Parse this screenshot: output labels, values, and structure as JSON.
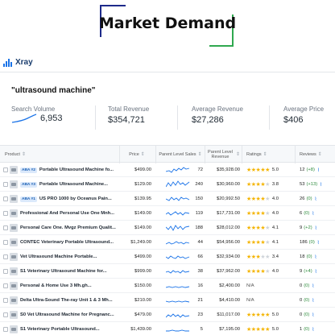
{
  "banner": {
    "title": "Market Demand"
  },
  "app": {
    "name": "Xray"
  },
  "query": "\"ultrasound machine\"",
  "metrics": [
    {
      "label": "Search Volume",
      "value": "6,953"
    },
    {
      "label": "Total Revenue",
      "value": "$354,721"
    },
    {
      "label": "Average Revenue",
      "value": "$27,286"
    },
    {
      "label": "Average Price",
      "value": "$406"
    }
  ],
  "columns": {
    "product": "Product",
    "price": "Price",
    "sales": "Parent Level Sales",
    "revenue": "Parent Level Revenue",
    "ratings": "Ratings",
    "reviews": "Reviews"
  },
  "rows": [
    {
      "aba": "ABA #2",
      "name": "Portable Ultrasound Machine fo...",
      "price": "$499.00",
      "sales": "72",
      "revenue": "$35,928.00",
      "rating": 5.0,
      "rating_text": "5.0",
      "reviews": "12",
      "delta": "(+8)"
    },
    {
      "aba": "ABA #3",
      "name": "Portable Ultrasound Machine...",
      "price": "$129.00",
      "sales": "240",
      "revenue": "$30,960.00",
      "rating": 3.8,
      "rating_text": "3.8",
      "reviews": "53",
      "delta": "(+13)"
    },
    {
      "aba": "ABA #1",
      "name": "US PRO 1000 by Oceanus Pain...",
      "price": "$139.95",
      "sales": "150",
      "revenue": "$20,992.50",
      "rating": 4.0,
      "rating_text": "4.0",
      "reviews": "26",
      "delta": "(0)"
    },
    {
      "aba": "",
      "name": "Professional And Personal Use One Mnh...",
      "price": "$149.00",
      "sales": "119",
      "revenue": "$17,731.00",
      "rating": 4.0,
      "rating_text": "4.0",
      "reviews": "6",
      "delta": "(0)"
    },
    {
      "aba": "",
      "name": "Personal Care One. Mvgz Premium Qualit...",
      "price": "$149.00",
      "sales": "188",
      "revenue": "$28,012.00",
      "rating": 4.1,
      "rating_text": "4.1",
      "reviews": "9",
      "delta": "(+2)"
    },
    {
      "aba": "",
      "name": "CONTEC Veterinary Portable Ultrasound...",
      "price": "$1,249.00",
      "sales": "44",
      "revenue": "$54,956.00",
      "rating": 4.1,
      "rating_text": "4.1",
      "reviews": "186",
      "delta": "(0)"
    },
    {
      "aba": "",
      "name": "Vet Ultrasound Machine Portable...",
      "price": "$499.00",
      "sales": "66",
      "revenue": "$32,934.00",
      "rating": 3.4,
      "rating_text": "3.4",
      "reviews": "18",
      "delta": "(0)"
    },
    {
      "aba": "",
      "name": "S1 Veterinary Ultrasound Machine for...",
      "price": "$999.00",
      "sales": "38",
      "revenue": "$37,962.00",
      "rating": 4.0,
      "rating_text": "4.0",
      "reviews": "9",
      "delta": "(+4)"
    },
    {
      "aba": "",
      "name": "Personal & Home Use 3 Mh.gh...",
      "price": "$150.00",
      "sales": "16",
      "revenue": "$2,400.00",
      "rating": null,
      "rating_text": "N/A",
      "reviews": "0",
      "delta": "(0)"
    },
    {
      "aba": "",
      "name": "Delta Ultra-Sound The-ray Unit 1 & 3 Mh...",
      "price": "$210.00",
      "sales": "21",
      "revenue": "$4,410.00",
      "rating": null,
      "rating_text": "N/A",
      "reviews": "0",
      "delta": "(0)"
    },
    {
      "aba": "",
      "name": "S0 Vet Ultrasound Machine for Pregnanc...",
      "price": "$479.00",
      "sales": "23",
      "revenue": "$11,017.00",
      "rating": 5.0,
      "rating_text": "5.0",
      "reviews": "0",
      "delta": "(0)"
    },
    {
      "aba": "",
      "name": "S1 Veterinary Portable Ultrasound...",
      "price": "$1,439.00",
      "sales": "5",
      "revenue": "$7,195.00",
      "rating": 5.0,
      "rating_text": "5.0",
      "reviews": "1",
      "delta": "(0)"
    }
  ],
  "colors": {
    "accent": "#1a73e8",
    "star": "#f4b400",
    "positive": "#2e8b3d"
  }
}
